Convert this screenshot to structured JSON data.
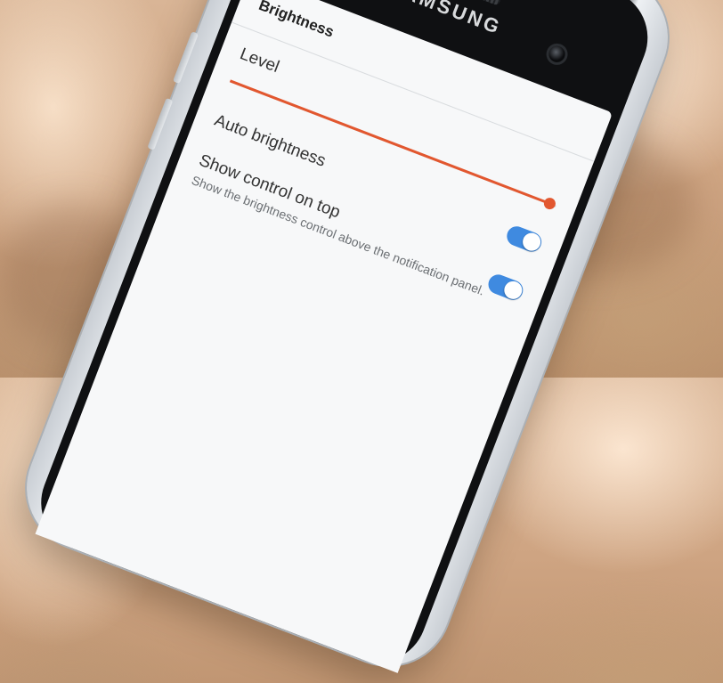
{
  "device": {
    "brand": "SAMSUNG"
  },
  "screen": {
    "title": "Brightness",
    "level": {
      "label": "Level",
      "value_fraction": 0.98
    },
    "auto_brightness": {
      "label": "Auto brightness",
      "enabled": true
    },
    "show_control": {
      "label": "Show control on top",
      "description": "Show the brightness control above the notification panel.",
      "enabled": true
    }
  },
  "colors": {
    "accent": "#e2572f",
    "toggle_on": "#3f8ae0"
  }
}
